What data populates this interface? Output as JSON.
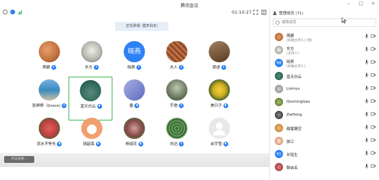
{
  "window": {
    "title": "腾讯会议"
  },
  "toolbar": {
    "timer": "01:10:27"
  },
  "banner": {
    "text": "正在讲话: 蓝天白云;"
  },
  "participants": [
    {
      "name": "燕郦",
      "avatar_type": "photo",
      "color": "#c0703a"
    },
    {
      "name": "东方",
      "avatar_type": "photo",
      "color": "#b8b8b0"
    },
    {
      "name": "晓燕",
      "avatar_type": "text",
      "avatar_text": "晓燕"
    },
    {
      "name": "夫人",
      "avatar_type": "photo",
      "color": "#b0603a"
    },
    {
      "name": "梁逑",
      "avatar_type": "photo",
      "color": "#7a5a3a"
    },
    {
      "name": "张婷婷（Grace)",
      "avatar_type": "photo",
      "color": "#3a8ac0"
    },
    {
      "name": "蓝天白云",
      "avatar_type": "photo",
      "color": "#2f6a5a"
    },
    {
      "name": "量",
      "avatar_type": "photo",
      "color": "#5a6ac0"
    },
    {
      "name": "宇驰",
      "avatar_type": "photo",
      "color": "#5a6a50"
    },
    {
      "name": "美日子",
      "avatar_type": "photo",
      "color": "#d0b020"
    },
    {
      "name": "流水不争先",
      "avatar_type": "photo",
      "color": "#c04040"
    },
    {
      "name": "强韶束",
      "avatar_type": "photo",
      "color": "#f0a070"
    },
    {
      "name": "杨丽花",
      "avatar_type": "photo",
      "color": "#8a4a4a"
    },
    {
      "name": "刘达",
      "avatar_type": "photo",
      "color": "#3a6a3a"
    },
    {
      "name": "余宇莹",
      "avatar_type": "default"
    }
  ],
  "bottombar": {
    "hint": "点击查看..."
  },
  "sidepanel": {
    "header": "管理成员 (71)",
    "search_placeholder": "搜索成员",
    "members": [
      {
        "name": "燕郦",
        "sub": "(如维主持人) (我)",
        "avatar_type": "photo",
        "color": "#c0703a"
      },
      {
        "name": "东方",
        "sub": "(主持人)",
        "avatar_type": "photo",
        "color": "#b8b8b0"
      },
      {
        "name": "晓燕",
        "sub": "(如维主持人)",
        "avatar_type": "text",
        "avatar_text": "晓燕"
      },
      {
        "name": "蓝天白云",
        "sub": "",
        "avatar_type": "photo",
        "color": "#2f6a5a"
      },
      {
        "name": "Lixinyu",
        "sub": "",
        "avatar_type": "photo",
        "color": "#a0a0a0"
      },
      {
        "name": "QiumingGao",
        "sub": "",
        "avatar_type": "photo",
        "color": "#6a8a3a"
      },
      {
        "name": "ZwHong",
        "sub": "",
        "avatar_type": "photo",
        "color": "#4a4a4a"
      },
      {
        "name": "甜蜜嫩空",
        "sub": "",
        "avatar_type": "photo",
        "color": "#d09040"
      },
      {
        "name": "旅江",
        "sub": "",
        "avatar_type": "photo",
        "color": "#e0a080"
      },
      {
        "name": "孙铭生",
        "sub": "",
        "avatar_type": "text",
        "avatar_text": "铭生"
      },
      {
        "name": "聊启名",
        "sub": "",
        "avatar_type": "photo",
        "color": "#b04a4a"
      }
    ]
  }
}
